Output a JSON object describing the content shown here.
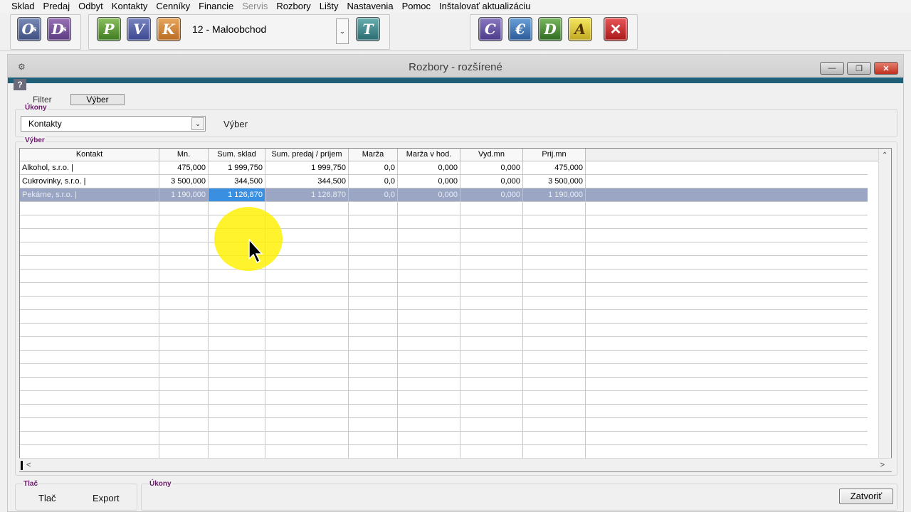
{
  "menu": {
    "items": [
      {
        "label": "Sklad",
        "disabled": false
      },
      {
        "label": "Predaj",
        "disabled": false
      },
      {
        "label": "Odbyt",
        "disabled": false
      },
      {
        "label": "Kontakty",
        "disabled": false
      },
      {
        "label": "Cenníky",
        "disabled": false
      },
      {
        "label": "Financie",
        "disabled": false
      },
      {
        "label": "Servis",
        "disabled": true
      },
      {
        "label": "Rozbory",
        "disabled": false
      },
      {
        "label": "Lišty",
        "disabled": false
      },
      {
        "label": "Nastavenia",
        "disabled": false
      },
      {
        "label": "Pomoc",
        "disabled": false
      },
      {
        "label": "Inštalovať aktualizáciu",
        "disabled": false
      }
    ]
  },
  "toolbar": {
    "store_selector": "12 - Maloobchod",
    "buttons": [
      {
        "letter": "O",
        "sub": "s",
        "icon": "os-icon"
      },
      {
        "letter": "D",
        "sub": "s",
        "icon": "ds-icon"
      },
      {
        "letter": "P",
        "icon": "p-icon"
      },
      {
        "letter": "V",
        "icon": "v-icon"
      },
      {
        "letter": "K",
        "icon": "k-icon"
      },
      {
        "letter": "T",
        "icon": "t-icon"
      },
      {
        "letter": "C",
        "icon": "c-icon"
      },
      {
        "letter": "€",
        "icon": "euro-icon"
      },
      {
        "letter": "D",
        "icon": "d-icon"
      },
      {
        "letter": "A",
        "icon": "a-icon"
      },
      {
        "letter": "✕",
        "icon": "close-x-icon"
      }
    ]
  },
  "window": {
    "title": "Rozbory - rozšírené",
    "help": "?",
    "filter_label": "Filter",
    "filter_tab": "Výber",
    "ukony_group": "Úkony",
    "ukony_select": "Kontakty",
    "ukony_side_label": "Výber",
    "vyber_group": "Výber",
    "tlac_group": "Tlač",
    "tlac_button": "Tlač",
    "export_button": "Export",
    "ukony_bottom_group": "Úkony",
    "close_button": "Zatvoriť"
  },
  "grid": {
    "columns": [
      "Kontakt",
      "Mn.",
      "Sum. sklad",
      "Sum. predaj / príjem",
      "Marža",
      "Marža v hod.",
      "Vyd.mn",
      "Prij.mn"
    ],
    "rows": [
      [
        "Alkohol, s.r.o. |",
        "475,000",
        "1 999,750",
        "1 999,750",
        "0,0",
        "0,000",
        "0,000",
        "475,000"
      ],
      [
        "Cukrovinky, s.r.o. |",
        "3 500,000",
        "344,500",
        "344,500",
        "0,0",
        "0,000",
        "0,000",
        "3 500,000"
      ],
      [
        "Pekárne, s.r.o. |",
        "1 190,000",
        "1 126,870",
        "1 126,870",
        "0,0",
        "0,000",
        "0,000",
        "1 190,000"
      ]
    ],
    "selected_row": 2,
    "active_column": 2
  }
}
